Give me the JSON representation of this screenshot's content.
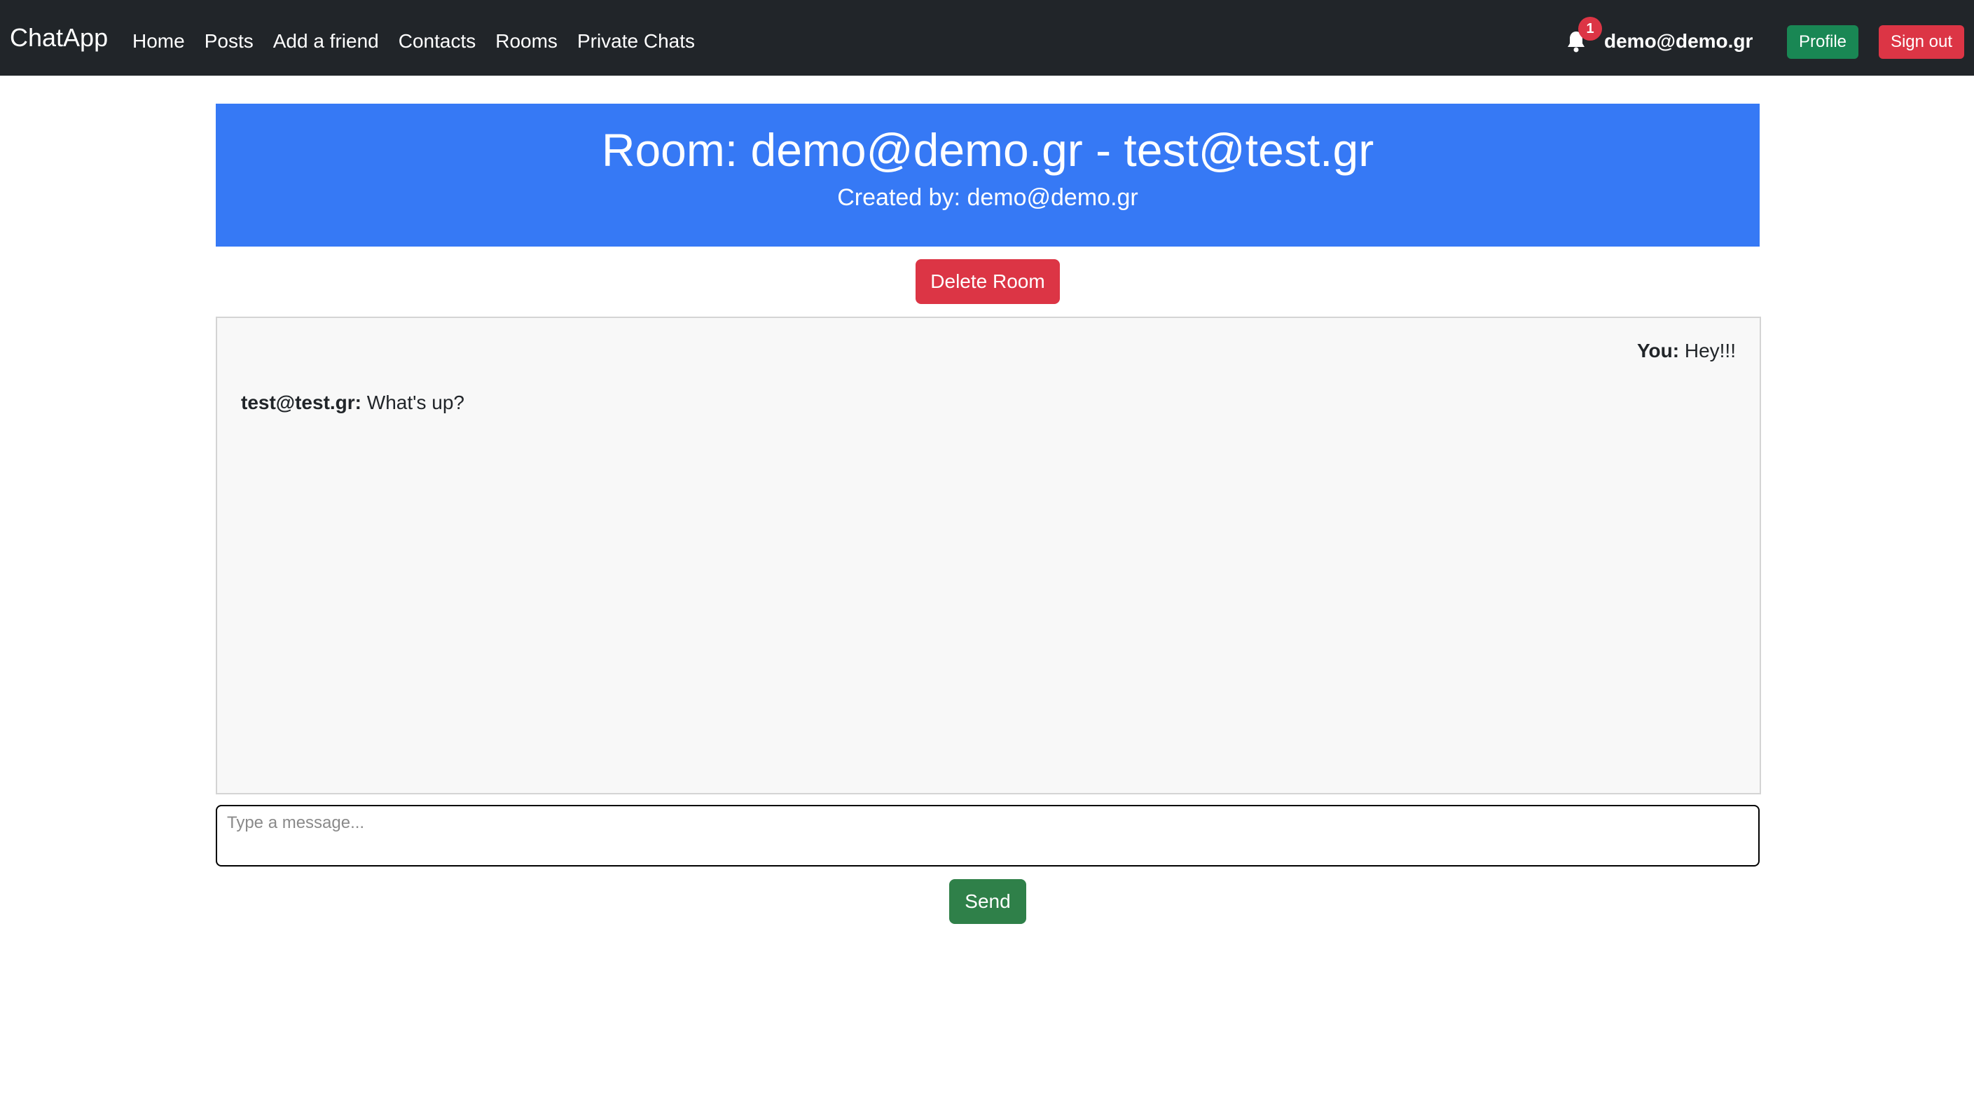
{
  "navbar": {
    "brand": "ChatApp",
    "links": [
      "Home",
      "Posts",
      "Add a friend",
      "Contacts",
      "Rooms",
      "Private Chats"
    ],
    "notification_count": "1",
    "notification_icon": "bell-icon",
    "user_email": "demo@demo.gr",
    "profile_label": "Profile",
    "signout_label": "Sign out"
  },
  "room": {
    "title": "Room: demo@demo.gr - test@test.gr",
    "creator": "Created by: demo@demo.gr",
    "delete_label": "Delete Room"
  },
  "messages": [
    {
      "sender": "You:",
      "text": "Hey!!!",
      "mine": true
    },
    {
      "sender": "test@test.gr:",
      "text": "What's up?",
      "mine": false
    }
  ],
  "composer": {
    "placeholder": "Type a message...",
    "value": "",
    "send_label": "Send"
  },
  "colors": {
    "navbar_bg": "#212529",
    "header_bg": "#3679f5",
    "danger": "#dc3545",
    "success": "#198754",
    "send": "#2f8049"
  }
}
